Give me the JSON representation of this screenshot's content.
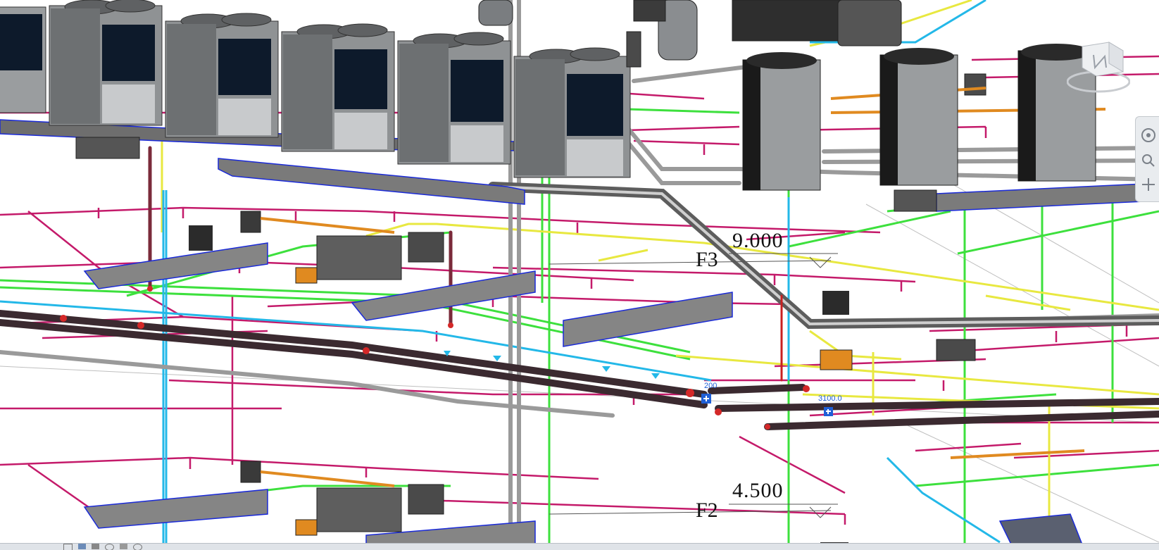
{
  "view": {
    "levels": [
      {
        "name": "F3",
        "elevation": "9.000"
      },
      {
        "name": "F2",
        "elevation": "4.500"
      }
    ],
    "dimension_tags": [
      "200",
      "3100.0"
    ]
  },
  "colors": {
    "refrigerant_pipe": "#3b2a30",
    "hanger": "#c41a6a",
    "condensate_pipe": "#3de03d",
    "drain_pipe": "#e8e840",
    "water_pipe": "#23b8e8",
    "air_duct_edge": "#1a2ad8",
    "duct_fitting": "#e08a20",
    "unit_body": "#888b8e",
    "unit_panel": "#0d1a2b"
  },
  "icons": [
    "viewcube-icon",
    "steering-wheel-icon",
    "zoom-icon",
    "pan-icon",
    "orbit-icon"
  ]
}
